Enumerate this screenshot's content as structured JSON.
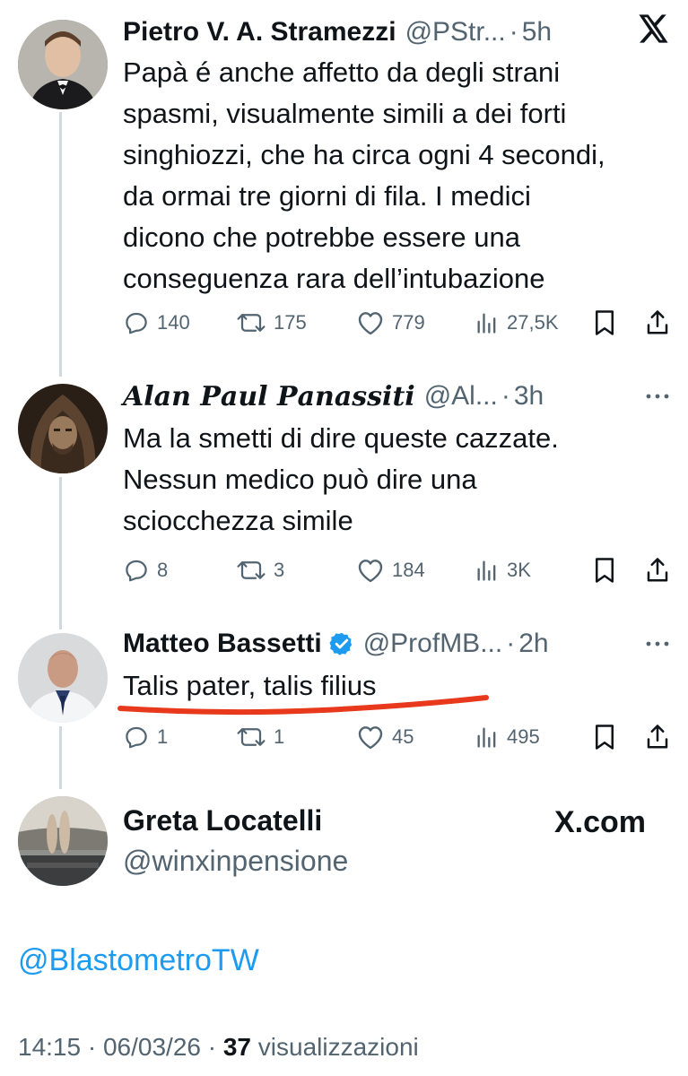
{
  "tweets": [
    {
      "name": "Pietro V. A. Stramezzi",
      "handle": "@PStr...",
      "dot": "·",
      "time": "5h",
      "lines": [
        "Papà é anche affetto da degli strani",
        "spasmi, visualmente simili a dei forti",
        "singhiozzi, che ha circa ogni 4 secondi,",
        "da ormai tre giorni di fila. I medici",
        "dicono che potrebbe essere una",
        "conseguenza rara dell’intubazione"
      ],
      "replies": "140",
      "retweets": "175",
      "likes": "779",
      "views": "27,5K"
    },
    {
      "name": "𝑨𝒍𝒂𝒏 𝑷𝒂𝒖𝒍 𝑷𝒂𝒏𝒂𝒔𝒔𝒊𝒕𝒊",
      "handle": "@Al...",
      "dot": "·",
      "time": "3h",
      "lines": [
        "Ma la smetti di dire queste cazzate.",
        "Nessun medico può dire una",
        "sciocchezza simile"
      ],
      "replies": "8",
      "retweets": "3",
      "likes": "184",
      "views": "3K"
    },
    {
      "name": "Matteo Bassetti",
      "handle": "@ProfMB...",
      "dot": "·",
      "time": "2h",
      "lines": [
        "Talis pater, talis filius"
      ],
      "replies": "1",
      "retweets": "1",
      "likes": "45",
      "views": "495"
    }
  ],
  "quoted_account": {
    "name": "Greta Locatelli",
    "handle": "@winxinpensione",
    "site_label": "X.com"
  },
  "mention": "@BlastometroTW",
  "footer": {
    "time": "14:15",
    "sep": "·",
    "date": "06/03/26",
    "sep2": "·",
    "views_count": "37",
    "views_label": "visualizzazioni"
  },
  "colors": {
    "text": "#0f1419",
    "secondary": "#536471",
    "link": "#1d9bf0",
    "verified": "#1d9bf0",
    "underline": "#e8391c"
  },
  "icons": [
    "x-logo-icon",
    "more-icon",
    "reply-icon",
    "retweet-icon",
    "like-icon",
    "views-icon",
    "bookmark-icon",
    "share-icon",
    "verified-badge-icon"
  ]
}
